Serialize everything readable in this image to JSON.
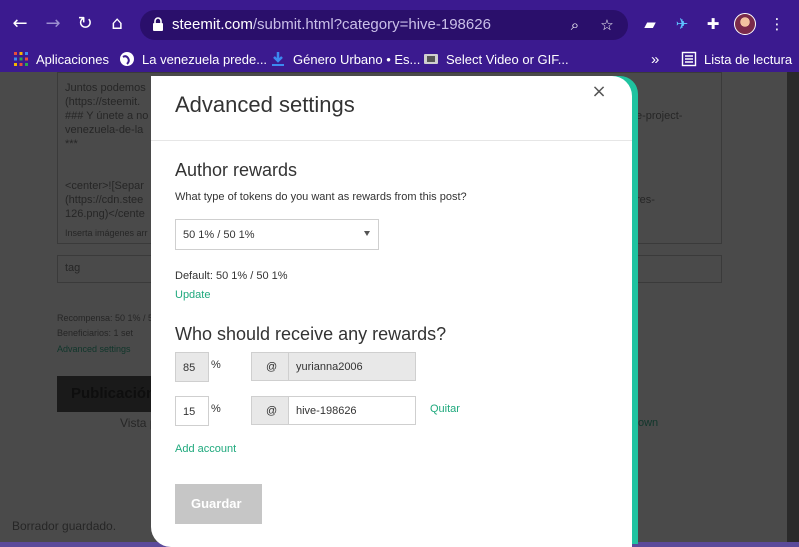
{
  "browser": {
    "url_domain": "steemit.com",
    "url_path": "/submit.html?category=hive-198626",
    "bookmarks": [
      {
        "label": "Aplicaciones"
      },
      {
        "label": "La venezuela prede..."
      },
      {
        "label": "Género Urbano • Es..."
      },
      {
        "label": "Select Video or GIF..."
      }
    ],
    "overflow": "»",
    "reading_list": "Lista de lectura"
  },
  "background": {
    "line1": "Juntos podemos",
    "line2": "(https://steemit.",
    "line3": "### Y únete a no",
    "line3b": "e-project-",
    "line4": "venezuela-de-la",
    "line5": "***",
    "line6": "<center>![Separ",
    "line7": "(https://cdn.stee",
    "line7b": "res-",
    "line8": "126.png)</cente",
    "line9": "Inserta imágenes arr",
    "tag_placeholder": "tag",
    "rewards": "Recompensa: 50 1% / 5",
    "beneficiaries": "Beneficiarios: 1 set",
    "advanced": "Advanced settings",
    "publish": "Publicación",
    "view": "Vista p",
    "own": "own",
    "saved": "Borrador guardado."
  },
  "modal": {
    "title": "Advanced settings",
    "close": "×",
    "author_rewards": {
      "title": "Author rewards",
      "question": "What type of tokens do you want as rewards from this post?",
      "selected": "50 1% / 50 1%",
      "default": "Default: 50 1% / 50 1%",
      "update": "Update"
    },
    "beneficiaries": {
      "title": "Who should receive any rewards?",
      "rows": [
        {
          "pct": "85",
          "sign": "%",
          "at": "@",
          "account": "yurianna2006"
        },
        {
          "pct": "15",
          "sign": "%",
          "at": "@",
          "account": "hive-198626",
          "remove": "Quitar"
        }
      ],
      "add_account": "Add account"
    },
    "save": "Guardar"
  }
}
